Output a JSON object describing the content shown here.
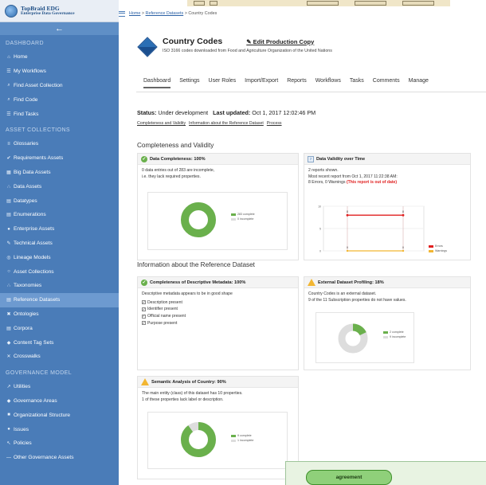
{
  "brand": {
    "name": "TopBraid EDG",
    "subtitle": "Enterprise Data Governance"
  },
  "sidebar": {
    "collapse_icon": "arrow-left-icon",
    "sections": [
      {
        "label": "DASHBOARD",
        "items": [
          {
            "label": "Home",
            "icon": "home-icon"
          },
          {
            "label": "My Workflows",
            "icon": "workflow-icon"
          },
          {
            "label": "Find Asset Collection",
            "icon": "search-icon"
          },
          {
            "label": "Find Code",
            "icon": "search-icon"
          },
          {
            "label": "Find Tasks",
            "icon": "tasks-icon"
          }
        ]
      },
      {
        "label": "ASSET COLLECTIONS",
        "items": [
          {
            "label": "Glossaries",
            "icon": "glossary-icon"
          },
          {
            "label": "Requirements Assets",
            "icon": "requirements-icon"
          },
          {
            "label": "Big Data Assets",
            "icon": "bigdata-icon"
          },
          {
            "label": "Data Assets",
            "icon": "data-assets-icon"
          },
          {
            "label": "Datatypes",
            "icon": "datatype-icon"
          },
          {
            "label": "Enumerations",
            "icon": "enumeration-icon"
          },
          {
            "label": "Enterprise Assets",
            "icon": "enterprise-icon"
          },
          {
            "label": "Technical Assets",
            "icon": "technical-icon"
          },
          {
            "label": "Lineage Models",
            "icon": "lineage-icon"
          },
          {
            "label": "Asset Collections",
            "icon": "collection-icon"
          },
          {
            "label": "Taxonomies",
            "icon": "taxonomy-icon"
          },
          {
            "label": "Reference Datasets",
            "icon": "reference-icon",
            "active": true
          },
          {
            "label": "Ontologies",
            "icon": "ontology-icon"
          },
          {
            "label": "Corpora",
            "icon": "corpora-icon"
          },
          {
            "label": "Content Tag Sets",
            "icon": "tag-icon"
          },
          {
            "label": "Crosswalks",
            "icon": "crosswalk-icon"
          }
        ]
      },
      {
        "label": "GOVERNANCE MODEL",
        "items": [
          {
            "label": "Utilities",
            "icon": "utilities-icon"
          },
          {
            "label": "Governance Areas",
            "icon": "areas-icon"
          },
          {
            "label": "Organizational Structure",
            "icon": "org-icon"
          },
          {
            "label": "Issues",
            "icon": "issues-icon"
          },
          {
            "label": "Policies",
            "icon": "policies-icon"
          },
          {
            "label": "Other Governance Assets",
            "icon": "other-icon"
          }
        ]
      }
    ]
  },
  "breadcrumb": {
    "home": "Home",
    "sep1": " > ",
    "parent": "Reference Datasets",
    "sep2": " > ",
    "current": "Country Codes"
  },
  "header": {
    "title": "Country Codes",
    "edit_link": "Edit Production Copy",
    "subtitle": "ISO 3166 codes downloaded from Food and Agriculture Organization of the United Nations"
  },
  "tabs": [
    "Dashboard",
    "Settings",
    "User Roles",
    "Import/Export",
    "Reports",
    "Workflows",
    "Tasks",
    "Comments",
    "Manage"
  ],
  "status": {
    "status_label": "Status:",
    "status_value": "Under development",
    "updated_label": "Last updated:",
    "updated_value": "Oct 1, 2017 12:02:46 PM",
    "links": [
      "Completeness and Validity",
      "Information about the Reference Dataset",
      "Process"
    ]
  },
  "sections": {
    "completeness": "Completeness and Validity",
    "information": "Information about the Reference Dataset"
  },
  "panels": {
    "data_completeness": {
      "title": "Data Completeness: 100%",
      "line1": "0 data entries out of 283 are incomplete,",
      "line2": "i.e. they lack required properties.",
      "legend_complete": "283 complete",
      "legend_incomplete": "0 incomplete",
      "complete_fraction": 1.0
    },
    "data_validity": {
      "title": "Data Validity over Time",
      "line1": "2 reports shown.",
      "line2": "Most recent report from Oct 1, 2017 11:22:38 AM:",
      "line3": "8 Errors, 0 Warnings",
      "line3_alert": "(This report is out of date)",
      "legend_errors": "Errors",
      "legend_warnings": "Warnings",
      "ylim": [
        0,
        10
      ],
      "yticks": [
        "10",
        "5",
        "0"
      ],
      "errors": [
        8,
        8
      ],
      "warnings": [
        0,
        0
      ],
      "point_labels": [
        "8",
        "8",
        "0",
        "0"
      ]
    },
    "descriptive_metadata": {
      "title": "Completeness of Descriptive Metadata: 100%",
      "line1": "Descriptive metadata appears to be in good shape",
      "checks": [
        "Description present",
        "Identifier present",
        "Official name present",
        "Purpose present"
      ]
    },
    "external_profiling": {
      "title": "External Dataset Profiling: 18%",
      "line1": "Country Codes is an external dataset.",
      "line2": "9 of the 11 Subscription properties do not have values.",
      "legend_complete": "2 complete",
      "legend_incomplete": "9 incomplete",
      "complete_fraction": 0.18
    },
    "semantic_analysis": {
      "title": "Semantic Analysis of Country: 90%",
      "line1": "The main entity (class) of this dataset has 10 properties.",
      "line2": "1 of these properties lack label or description.",
      "legend_complete": "9 complete",
      "legend_incomplete": "1 incomplete",
      "complete_fraction": 0.9
    }
  },
  "overlay": {
    "label": "agreement"
  },
  "colors": {
    "complete": "#6ab04c",
    "incomplete": "#dddddd",
    "errors": "#e02020",
    "warnings": "#f2b632",
    "sidebar": "#4a7cb8"
  }
}
